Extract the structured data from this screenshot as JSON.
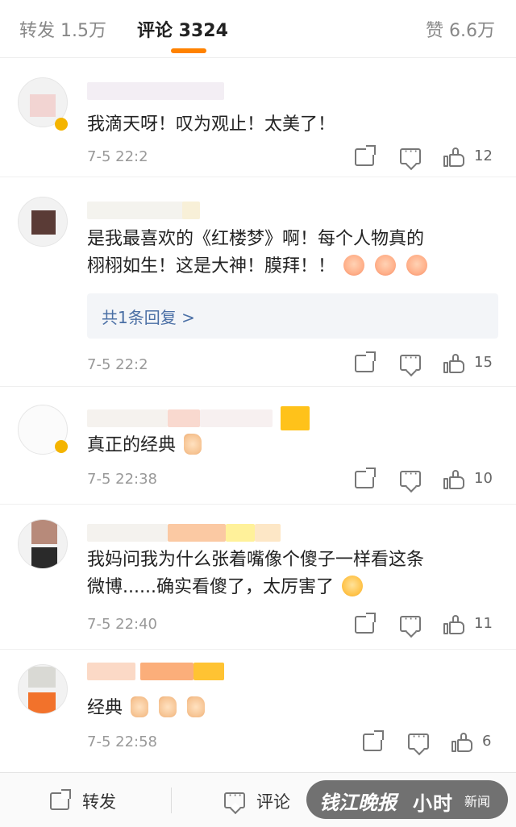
{
  "tabs": {
    "repost": "转发 1.5万",
    "comments": "评论 3324",
    "likes": "赞 6.6万"
  },
  "comments": [
    {
      "text": "我滴天呀！叹为观止！太美了！",
      "time": "7-5 22:2",
      "likes": "12"
    },
    {
      "text_line1": "是我最喜欢的《红楼梦》啊！每个人物真的",
      "text_line2": "栩栩如生！这是大神！膜拜！！",
      "reply": "共1条回复 >",
      "time": "7-5 22:2",
      "likes": "15"
    },
    {
      "text": "真正的经典",
      "time": "7-5 22:38",
      "likes": "10"
    },
    {
      "text_line1": "我妈问我为什么张着嘴像个傻子一样看这条",
      "text_line2": "微博......确实看傻了，太厉害了",
      "time": "7-5 22:40",
      "likes": "11"
    },
    {
      "text": "经典",
      "time": "7-5 22:58",
      "likes": "6"
    }
  ],
  "bottombar": {
    "repost": "转发",
    "comment": "评论"
  },
  "watermark": {
    "brand": "钱江晚报",
    "mark": "小时",
    "sub": "新闻"
  },
  "colors": {
    "accent": "#ff8200",
    "link": "#4a6fa5"
  }
}
